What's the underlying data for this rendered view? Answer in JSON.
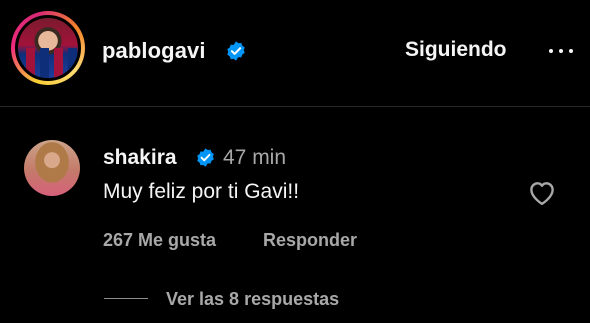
{
  "post_header": {
    "username": "pablogavi",
    "verified_icon": "verified-badge-icon",
    "follow_status": "Siguiendo",
    "more_icon": "more-options-icon"
  },
  "comment": {
    "author": "shakira",
    "verified_icon": "verified-badge-icon",
    "time": "47 min",
    "text": "Muy feliz por ti Gavi!!",
    "like_icon": "heart-outline-icon",
    "likes": "267 Me gusta",
    "reply_label": "Responder",
    "view_replies": "Ver las 8 respuestas"
  },
  "colors": {
    "background": "#000000",
    "primary_text": "#f5f5f5",
    "secondary_text": "#a8a8a8",
    "verified_blue": "#0095f6"
  }
}
